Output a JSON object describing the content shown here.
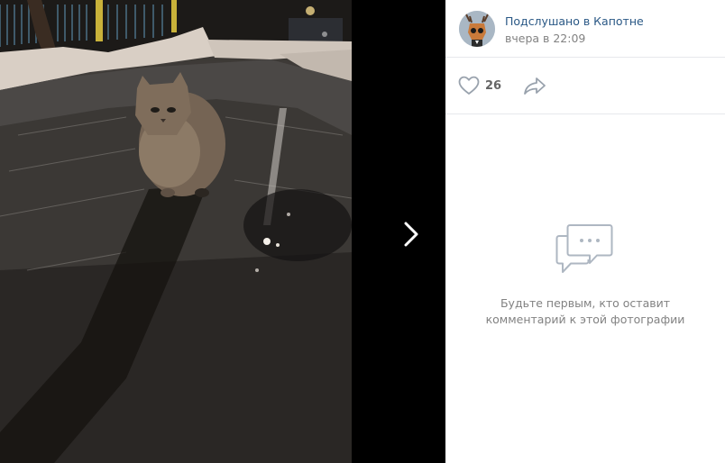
{
  "post": {
    "author": "Подслушано в Капотне",
    "date": "вчера в 22:09",
    "likes": "26"
  },
  "comments": {
    "empty_line1": "Будьте первым, кто оставит",
    "empty_line2": "комментарий к этой фотографии"
  },
  "icons": {
    "next": "chevron-right-icon",
    "like": "heart-icon",
    "share": "share-arrow-icon",
    "empty": "chat-bubbles-icon"
  },
  "colors": {
    "link": "#2a5885",
    "muted": "#828282",
    "icon": "#99a2ad",
    "divider": "#e7e8ec"
  }
}
